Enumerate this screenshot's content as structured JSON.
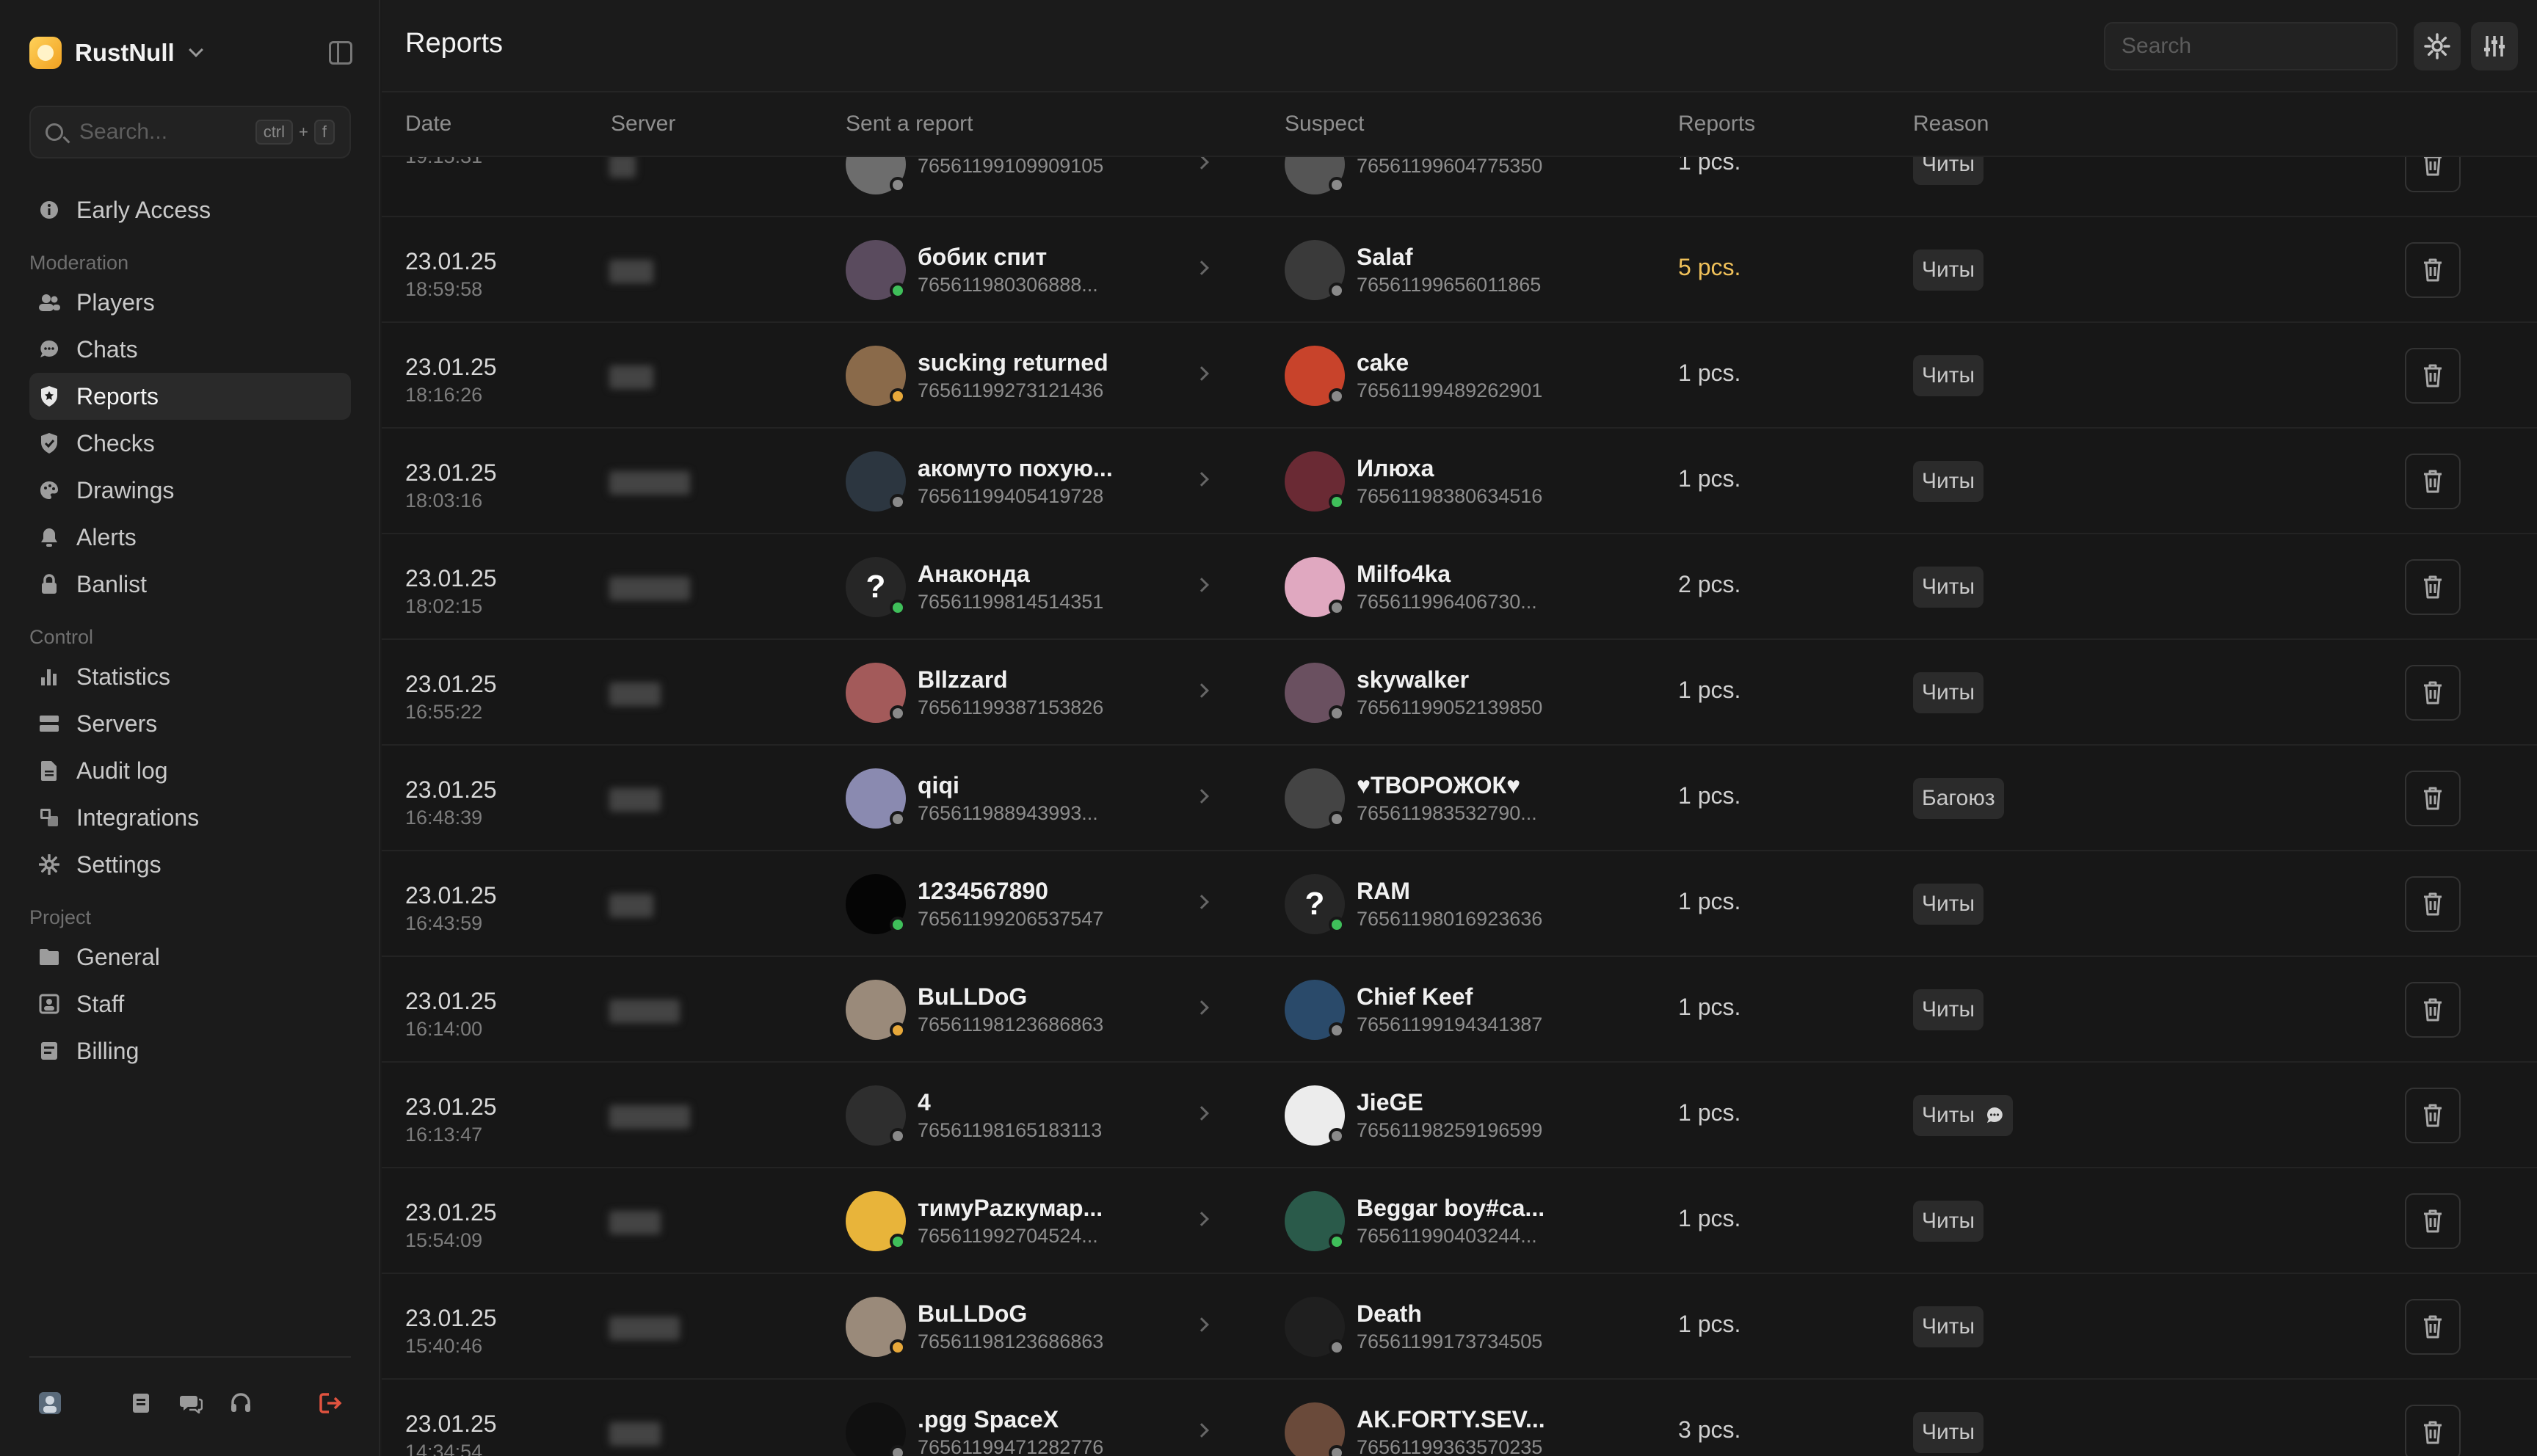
{
  "app": {
    "name": "RustNull"
  },
  "sidebar": {
    "search_placeholder": "Search...",
    "shortcut": {
      "key1": "ctrl",
      "plus": "+",
      "key2": "f"
    },
    "top_item": {
      "label": "Early Access",
      "icon": "info-icon"
    },
    "sections": [
      {
        "title": "Moderation",
        "items": [
          {
            "label": "Players",
            "icon": "users-icon"
          },
          {
            "label": "Chats",
            "icon": "chat-icon"
          },
          {
            "label": "Reports",
            "icon": "shield-icon",
            "active": true
          },
          {
            "label": "Checks",
            "icon": "shield-check-icon"
          },
          {
            "label": "Drawings",
            "icon": "palette-icon"
          },
          {
            "label": "Alerts",
            "icon": "bell-icon"
          },
          {
            "label": "Banlist",
            "icon": "lock-icon"
          }
        ]
      },
      {
        "title": "Control",
        "items": [
          {
            "label": "Statistics",
            "icon": "bar-chart-icon"
          },
          {
            "label": "Servers",
            "icon": "server-icon"
          },
          {
            "label": "Audit log",
            "icon": "file-icon"
          },
          {
            "label": "Integrations",
            "icon": "integrations-icon"
          },
          {
            "label": "Settings",
            "icon": "gear-icon"
          }
        ]
      },
      {
        "title": "Project",
        "items": [
          {
            "label": "General",
            "icon": "folder-icon"
          },
          {
            "label": "Staff",
            "icon": "staff-icon"
          },
          {
            "label": "Billing",
            "icon": "billing-icon"
          }
        ]
      }
    ]
  },
  "header": {
    "title": "Reports",
    "search_placeholder": "Search"
  },
  "table": {
    "columns": {
      "date": "Date",
      "server": "Server",
      "sender": "Sent a report",
      "suspect": "Suspect",
      "reports": "Reports",
      "reason": "Reason"
    },
    "rows": [
      {
        "date": "",
        "time": "19:15:31",
        "sender": {
          "name": "",
          "id": "76561199109909105",
          "status": "#8a8a8a",
          "avatar_color": "#6d6d6d"
        },
        "suspect": {
          "name": "",
          "id": "76561199604775350",
          "status": "#8a8a8a",
          "avatar_color": "#555555"
        },
        "reports": "1 pcs.",
        "reason": "Читы"
      },
      {
        "date": "23.01.25",
        "time": "18:59:58",
        "sender": {
          "name": "бобик спит",
          "id": "765611980306888...",
          "status": "#3fbf5a",
          "avatar_color": "#5a4b5e"
        },
        "suspect": {
          "name": "Salaf",
          "id": "76561199656011865",
          "status": "#8a8a8a",
          "avatar_color": "#3a3a3a"
        },
        "reports": "5 pcs.",
        "hot": true,
        "reason": "Читы"
      },
      {
        "date": "23.01.25",
        "time": "18:16:26",
        "sender": {
          "name": "sucking returned",
          "id": "76561199273121436",
          "status": "#e7a83a",
          "avatar_color": "#8a6a4a"
        },
        "suspect": {
          "name": "cake",
          "id": "76561199489262901",
          "status": "#8a8a8a",
          "avatar_color": "#c8432b"
        },
        "reports": "1 pcs.",
        "reason": "Читы"
      },
      {
        "date": "23.01.25",
        "time": "18:03:16",
        "sender": {
          "name": "акомуто похую...",
          "id": "76561199405419728",
          "status": "#8a8a8a",
          "avatar_color": "#2c3640"
        },
        "suspect": {
          "name": "Илюха",
          "id": "76561198380634516",
          "status": "#3fbf5a",
          "avatar_color": "#6a2a34"
        },
        "reports": "1 pcs.",
        "reason": "Читы"
      },
      {
        "date": "23.01.25",
        "time": "18:02:15",
        "sender": {
          "name": "Анаконда",
          "id": "76561199814514351",
          "status": "#3fbf5a",
          "avatar_color": "#262626",
          "glyph": "?"
        },
        "suspect": {
          "name": "Milfo4ka",
          "id": "765611996406730...",
          "status": "#8a8a8a",
          "avatar_color": "#e0a8c0"
        },
        "reports": "2 pcs.",
        "reason": "Читы"
      },
      {
        "date": "23.01.25",
        "time": "16:55:22",
        "sender": {
          "name": "Bllzzard",
          "id": "76561199387153826",
          "status": "#8a8a8a",
          "avatar_color": "#a35a5a"
        },
        "suspect": {
          "name": "skywalker",
          "id": "76561199052139850",
          "status": "#8a8a8a",
          "avatar_color": "#6a5060"
        },
        "reports": "1 pcs.",
        "reason": "Читы"
      },
      {
        "date": "23.01.25",
        "time": "16:48:39",
        "sender": {
          "name": "qiqi",
          "id": "765611988943993...",
          "status": "#8a8a8a",
          "avatar_color": "#8a8ab0"
        },
        "suspect": {
          "name": "♥ТВОРОЖОК♥",
          "id": "765611983532790...",
          "status": "#8a8a8a",
          "avatar_color": "#444444"
        },
        "reports": "1 pcs.",
        "reason": "Багоюз"
      },
      {
        "date": "23.01.25",
        "time": "16:43:59",
        "sender": {
          "name": "1234567890",
          "id": "76561199206537547",
          "status": "#3fbf5a",
          "avatar_color": "#050505"
        },
        "suspect": {
          "name": "RAM",
          "id": "76561198016923636",
          "status": "#3fbf5a",
          "avatar_color": "#262626",
          "glyph": "?"
        },
        "reports": "1 pcs.",
        "reason": "Читы"
      },
      {
        "date": "23.01.25",
        "time": "16:14:00",
        "sender": {
          "name": "BuLLDoG",
          "id": "76561198123686863",
          "status": "#e7a83a",
          "avatar_color": "#9a8a7a"
        },
        "suspect": {
          "name": "Chief Keef",
          "id": "76561199194341387",
          "status": "#8a8a8a",
          "avatar_color": "#2a4a6a"
        },
        "reports": "1 pcs.",
        "reason": "Читы"
      },
      {
        "date": "23.01.25",
        "time": "16:13:47",
        "sender": {
          "name": "4",
          "id": "76561198165183113",
          "status": "#8a8a8a",
          "avatar_color": "#2e2e2e"
        },
        "suspect": {
          "name": "JieGE",
          "id": "76561198259196599",
          "status": "#8a8a8a",
          "avatar_color": "#ececec"
        },
        "reports": "1 pcs.",
        "reason": "Читы",
        "chat": true
      },
      {
        "date": "23.01.25",
        "time": "15:54:09",
        "sender": {
          "name": "тимуPazкумар...",
          "id": "765611992704524...",
          "status": "#3fbf5a",
          "avatar_color": "#e8b43a"
        },
        "suspect": {
          "name": "Beggar boy#ca...",
          "id": "765611990403244...",
          "status": "#3fbf5a",
          "avatar_color": "#2a5a4a"
        },
        "reports": "1 pcs.",
        "reason": "Читы"
      },
      {
        "date": "23.01.25",
        "time": "15:40:46",
        "sender": {
          "name": "BuLLDoG",
          "id": "76561198123686863",
          "status": "#e7a83a",
          "avatar_color": "#9a8a7a"
        },
        "suspect": {
          "name": "Death",
          "id": "76561199173734505",
          "status": "#8a8a8a",
          "avatar_color": "#1f1f1f"
        },
        "reports": "1 pcs.",
        "reason": "Читы"
      },
      {
        "date": "23.01.25",
        "time": "14:34:54",
        "sender": {
          "name": ".pgg SpaceX",
          "id": "76561199471282776",
          "status": "#8a8a8a",
          "avatar_color": "#101010"
        },
        "suspect": {
          "name": "AK.FORTY.SEV...",
          "id": "76561199363570235",
          "status": "#8a8a8a",
          "avatar_color": "#6a4a3a"
        },
        "reports": "3 pcs.",
        "reason": "Читы"
      }
    ]
  }
}
